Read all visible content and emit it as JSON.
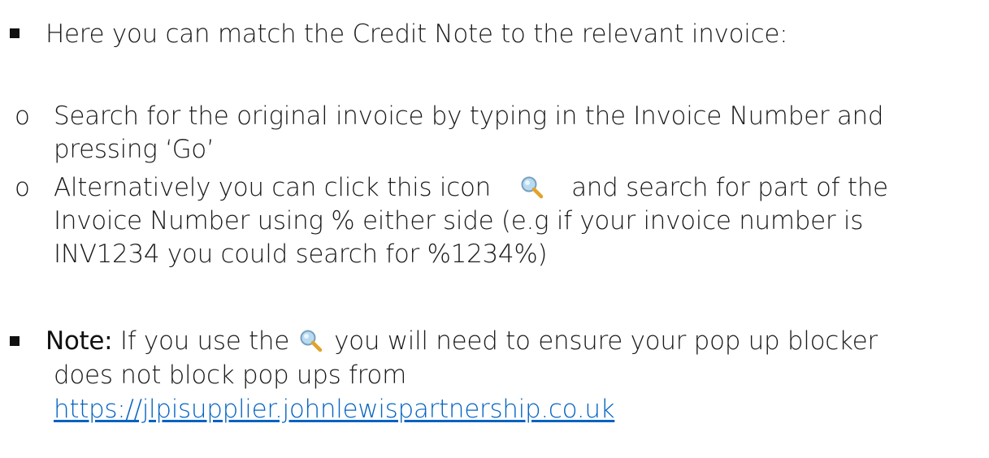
{
  "bullets": {
    "intro": "Here you can match the Credit Note to the relevant invoice:",
    "option1": {
      "line1": "Search for the original invoice by typing in the Invoice Number and",
      "line2": "pressing ‘Go’"
    },
    "option2": {
      "line1_before_icon": "Alternatively you can click this icon",
      "line1_after_icon": "and search for part of the",
      "line2": "Invoice Number using % either side (e.g if your invoice number is",
      "line3": "INV1234 you could search for %1234%)"
    },
    "note": {
      "label": "Note:",
      "line1_before_icon": "If you use the",
      "line1_after_icon": "you will need to ensure your pop up blocker",
      "line2": "does not block pop ups from",
      "link": "https://jlpisupplier.johnlewispartnership.co.uk"
    }
  },
  "sub_bullet_marker": "o",
  "icons": {
    "search": "magnifier-icon"
  },
  "colors": {
    "text": "#1a1a1a",
    "link": "#0563c1",
    "icon_lens": "#9cc9ea",
    "icon_handle": "#e0a32b"
  }
}
